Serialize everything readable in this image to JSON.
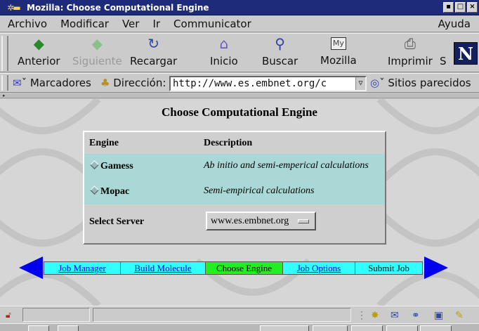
{
  "window": {
    "title": "Mozilla: Choose Computational Engine",
    "buttons": [
      "▪",
      "□",
      "×"
    ]
  },
  "menubar": {
    "items": [
      "Archivo",
      "Modificar",
      "Ver",
      "Ir",
      "Communicator"
    ],
    "help": "Ayuda"
  },
  "toolbar": {
    "back": "Anterior",
    "forward": "Siguiente",
    "reload": "Recargar",
    "home": "Inicio",
    "search": "Buscar",
    "mozilla": "Mozilla",
    "print": "Imprimir",
    "security": "S",
    "logo": "N"
  },
  "locationbar": {
    "bookmarks": "Marcadores",
    "address_label": "Dirección:",
    "url": "http://www.es.embnet.org/c",
    "related": "Sitios parecidos"
  },
  "page": {
    "heading": "Choose Computational Engine",
    "table": {
      "col_engine": "Engine",
      "col_description": "Description",
      "rows": [
        {
          "engine": "Gamess",
          "description": "Ab initio and semi-emperical calculations"
        },
        {
          "engine": "Mopac",
          "description": "Semi-empirical calculations"
        }
      ],
      "server_label": "Select Server",
      "server_value": "www.es.embnet.org"
    },
    "nav": {
      "items": [
        "Job Manager",
        "Build Molecule",
        "Choose Engine",
        "Job Options",
        "Submit Job"
      ],
      "active": "Choose Engine"
    }
  }
}
